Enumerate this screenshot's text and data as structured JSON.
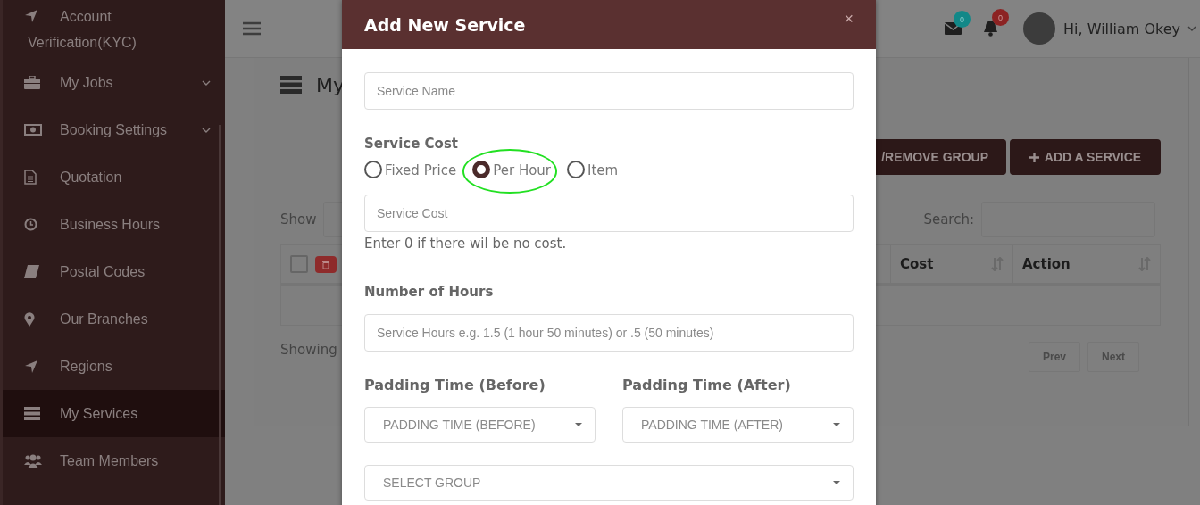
{
  "sidebar": {
    "items": [
      {
        "label": "Account Verification(KYC)",
        "expandable": false,
        "selected": false
      },
      {
        "label": "My Jobs",
        "expandable": true,
        "selected": false
      },
      {
        "label": "Booking Settings",
        "expandable": true,
        "selected": false
      },
      {
        "label": "Quotation",
        "expandable": false,
        "selected": false
      },
      {
        "label": "Business Hours",
        "expandable": false,
        "selected": false
      },
      {
        "label": "Postal Codes",
        "expandable": false,
        "selected": false
      },
      {
        "label": "Our Branches",
        "expandable": false,
        "selected": false
      },
      {
        "label": "Regions",
        "expandable": false,
        "selected": false
      },
      {
        "label": "My Services",
        "expandable": false,
        "selected": true
      },
      {
        "label": "Team Members",
        "expandable": false,
        "selected": false
      }
    ]
  },
  "topbar": {
    "mail_count": "0",
    "notification_count": "0",
    "greeting": "Hi, William Okey"
  },
  "page": {
    "title": "My",
    "buttons": [
      {
        "label": "/REMOVE GROUP",
        "kind": "plain"
      },
      {
        "label": "ADD A SERVICE",
        "kind": "add"
      }
    ],
    "show_label": "Show",
    "search_label": "Search:",
    "table": {
      "select_all": {
        "checked": false
      },
      "columns": [
        "Cost",
        "Action"
      ]
    },
    "info": "Showing",
    "pagination": [
      "Prev",
      "Next"
    ]
  },
  "modal": {
    "title": "Add New Service",
    "close": "×",
    "service_name": {
      "placeholder": "Service Name"
    },
    "cost_label": "Service Cost",
    "cost_types": [
      {
        "label": "Fixed Price",
        "selected": false,
        "highlighted": false
      },
      {
        "label": "Per Hour",
        "selected": true,
        "highlighted": true
      },
      {
        "label": "Item",
        "selected": false,
        "highlighted": false
      }
    ],
    "service_cost": {
      "placeholder": "Service Cost"
    },
    "cost_help": "Enter 0 if there wil be no cost.",
    "hours_label": "Number of Hours",
    "hours": {
      "placeholder": "Service Hours e.g. 1.5 (1 hour 50 minutes) or .5 (50 minutes)"
    },
    "padding_before": {
      "label": "Padding Time (Before)",
      "placeholder": "PADDING TIME (BEFORE)"
    },
    "padding_after": {
      "label": "Padding Time (After)",
      "placeholder": "PADDING TIME (AFTER)"
    },
    "group": {
      "placeholder": "SELECT GROUP"
    }
  }
}
